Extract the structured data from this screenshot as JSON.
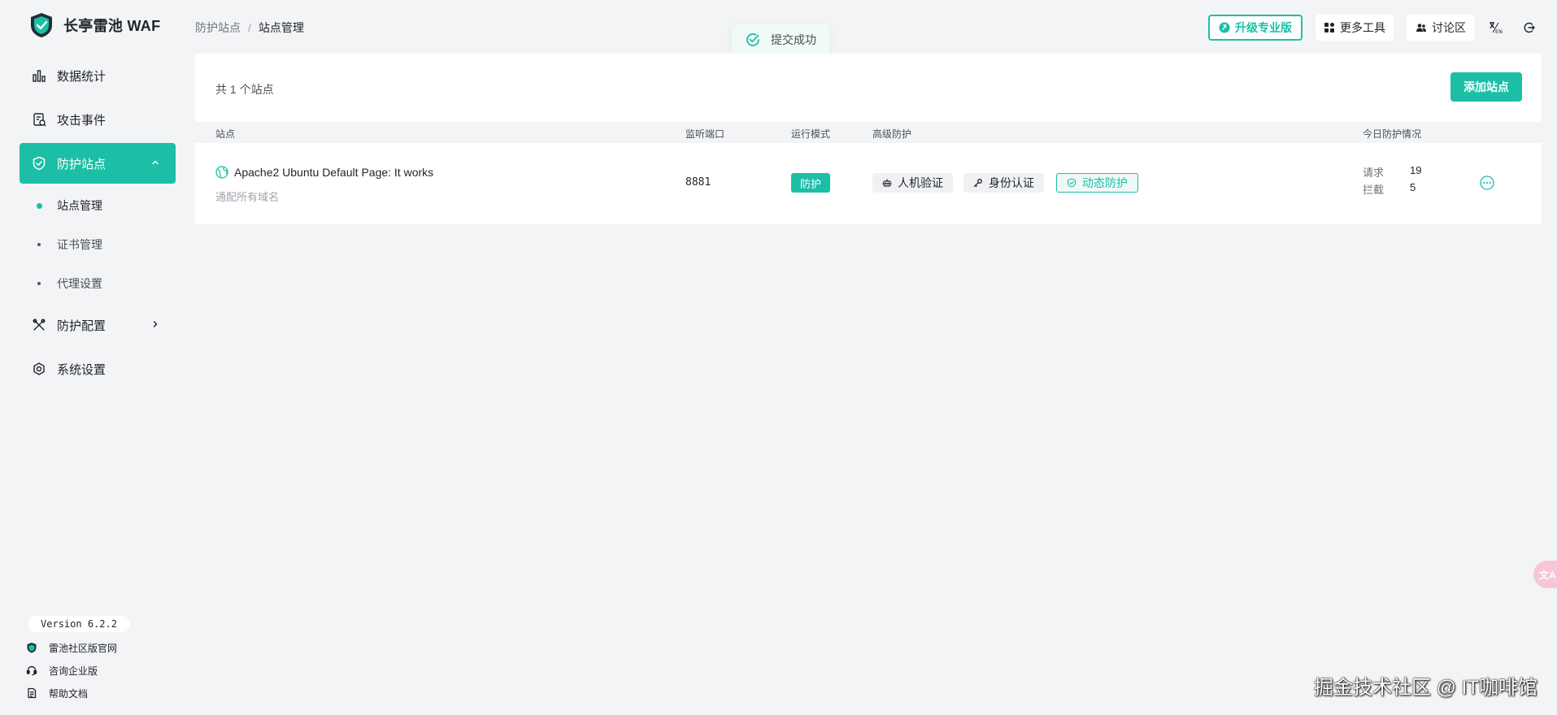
{
  "brand": {
    "name": "长亭雷池 WAF"
  },
  "sidebar": {
    "items": [
      {
        "label": "数据统计",
        "icon": "bar-chart-icon"
      },
      {
        "label": "攻击事件",
        "icon": "event-icon"
      },
      {
        "label": "防护站点",
        "icon": "shield-icon",
        "active": true
      },
      {
        "label": "防护配置",
        "icon": "tools-icon"
      },
      {
        "label": "系统设置",
        "icon": "gear-icon"
      }
    ],
    "sub_items": [
      {
        "label": "站点管理",
        "active": true
      },
      {
        "label": "证书管理"
      },
      {
        "label": "代理设置"
      }
    ],
    "version": "Version 6.2.2",
    "footer_links": [
      {
        "label": "雷池社区版官网",
        "icon": "logo-small-icon"
      },
      {
        "label": "咨询企业版",
        "icon": "headset-icon"
      },
      {
        "label": "帮助文档",
        "icon": "document-icon"
      }
    ]
  },
  "header": {
    "breadcrumb": [
      "防护站点",
      "站点管理"
    ],
    "upgrade_label": "升级专业版",
    "tools_label": "更多工具",
    "forum_label": "讨论区"
  },
  "toast": {
    "message": "提交成功"
  },
  "sites": {
    "total_text": "共 1 个站点",
    "add_label": "添加站点",
    "columns": {
      "site": "站点",
      "port": "监听端口",
      "mode": "运行模式",
      "advanced": "高级防护",
      "today": "今日防护情况"
    },
    "rows": [
      {
        "title": "Apache2 Ubuntu Default Page: It works",
        "domain": "通配所有域名",
        "port": "8881",
        "mode": "防护",
        "tags": [
          "人机验证",
          "身份认证",
          "动态防护"
        ],
        "requests_label": "请求",
        "requests": "19",
        "blocked_label": "拦截",
        "blocked": "5"
      }
    ]
  },
  "colors": {
    "accent": "#1cbfa6",
    "background": "#f3f4f6"
  },
  "watermark": "掘金技术社区 @ IT咖啡馆"
}
